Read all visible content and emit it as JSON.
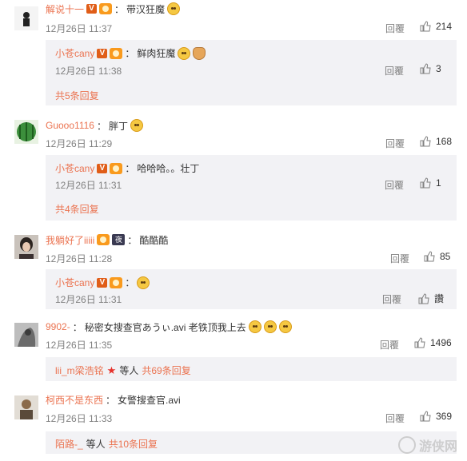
{
  "colors": {
    "username": "#eb7350",
    "meta": "#808080",
    "reply_bg": "#f2f2f5"
  },
  "comments": [
    {
      "user": "解说十一",
      "sep": "：",
      "text": "带汉狂魔",
      "time": "12月26日 11:37",
      "reply_label": "回覆",
      "likes": "214",
      "reply": {
        "user": "小苍cany",
        "sep": "：",
        "text": "鲜肉狂魔",
        "time": "12月26日 11:38",
        "reply_label": "回覆",
        "likes": "3"
      },
      "more": "共5条回复"
    },
    {
      "user": "Guooo1116",
      "sep": "：",
      "text": "胖丁",
      "time": "12月26日 11:29",
      "reply_label": "回覆",
      "likes": "168",
      "reply": {
        "user": "小苍cany",
        "sep": "：",
        "text": "哈哈哈。。壮丁",
        "time": "12月26日 11:31",
        "reply_label": "回覆",
        "likes": "1"
      },
      "more": "共4条回复"
    },
    {
      "user": "我躺好了iiiii",
      "badge": "夜",
      "sep": "：",
      "text": "酷酷酷",
      "time": "12月26日 11:28",
      "reply_label": "回覆",
      "likes": "85",
      "reply": {
        "user": "小苍cany",
        "sep": "：",
        "text": "",
        "time": "12月26日 11:31",
        "reply_label": "回覆",
        "likes": "讚"
      }
    },
    {
      "user": "9902-",
      "sep": "：",
      "text": "秘密女搜查官あうぃ.avi 老铁顶我上去",
      "time": "12月26日 11:35",
      "reply_label": "回覆",
      "likes": "1496",
      "more_user": "lii_m梁浩铭",
      "more_mid": "等人",
      "more": "共69条回复"
    },
    {
      "user": "柯西不是东西",
      "sep": "：",
      "text": "女警搜查官.avi",
      "time": "12月26日 11:33",
      "reply_label": "回覆",
      "likes": "369",
      "more_user": "陌路-_",
      "more_mid": "等人",
      "more": "共10条回复"
    }
  ],
  "watermark": "游侠网"
}
